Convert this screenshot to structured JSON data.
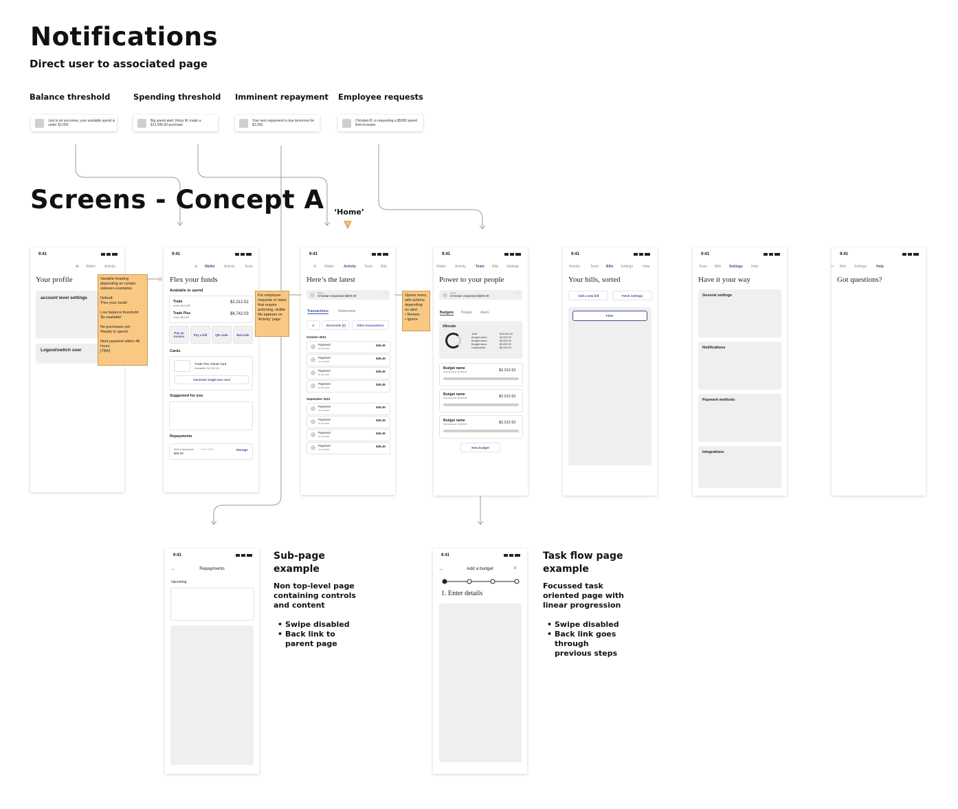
{
  "headings": {
    "notifications": "Notifications",
    "notifications_sub": "Direct user to associated page",
    "screens": "Screens - Concept A",
    "home_label": "‘Home’"
  },
  "notifications": [
    {
      "title": "Balance threshold",
      "text": "Just to let you know, your available spend is under $2,000"
    },
    {
      "title": "Spending threshold",
      "text": "Big spend alert: Ricky M. made a $12,045.00 purchase"
    },
    {
      "title": "Imminent repayment",
      "text": "Your next repayment is due tomorrow for $1,500."
    },
    {
      "title": "Employee requests",
      "text": "Christian B. is requesting a $5000 spend limit increase."
    }
  ],
  "status_time": "9:41",
  "profile": {
    "nav": [
      "Wallet",
      "Activity"
    ],
    "title": "Your profile",
    "account_settings": "account level settings",
    "logout": "Logout/switch user",
    "sticky": "Variable heading depending on certain statuses examples:\n\nDefault:\n'Flex your funds'\n\nLow balance threshold:\n'$x available'\n\nNo purchases yet:\n'Ready to spend'\n\nNext payment within 48 hours\n[TBA]'"
  },
  "wallet": {
    "nav": [
      "Wallet",
      "Activity",
      "Team"
    ],
    "title": "Flex your funds",
    "available": "Available to spend",
    "trade": "Trade",
    "trade_sub": "Limit: $10,000",
    "trade_value": "$2,312.52",
    "trade_plus": "Trade Plus",
    "trade_plus_sub": "Limit: $5,000",
    "trade_plus_value": "$6,742.03",
    "actions": [
      "Pay an invoice",
      "Pay a bill",
      "QR code",
      "Barcode"
    ],
    "cards": "Cards",
    "card_name": "Trade Flex Virtual Card",
    "card_sub": "Available: $1,312.52",
    "generate": "Generate single-use card",
    "suggested": "Suggested for you",
    "repayments": "Repayments",
    "next_repayment": "Next repayment:",
    "next_date": "1 Dec 2021",
    "next_amount": "$45.03",
    "manage": "Manage",
    "sticky": "For employee requests or tasks that require actioning, visible tile appears on 'Activity' page"
  },
  "activity": {
    "nav": [
      "Wallet",
      "Activity",
      "Team",
      "Bills"
    ],
    "title": "Here’s the latest",
    "alert_small": "Action",
    "alert": "Christian requested $500.00",
    "tabs": [
      "Transactions",
      "Statements"
    ],
    "reconcile": "Reconcile (2)",
    "filter": "Filter transactions",
    "month1": "October 2021",
    "month2": "September 2021",
    "rows1": [
      {
        "label": "Payment",
        "date": "13 Oct 2021",
        "amount": "$45.45"
      },
      {
        "label": "Payment",
        "date": "12 Oct 2021",
        "amount": "$45.45"
      },
      {
        "label": "Payment",
        "date": "10 Oct 2021",
        "amount": "$45.45"
      },
      {
        "label": "Payment",
        "date": "10 Oct 2021",
        "amount": "$45.45"
      }
    ],
    "rows2": [
      {
        "label": "Payment",
        "date": "12 Oct 2021",
        "amount": "$45.45"
      },
      {
        "label": "Payment",
        "date": "12 Oct 2021",
        "amount": "$45.45"
      },
      {
        "label": "Payment",
        "date": "12 Oct 2021",
        "amount": "$45.45"
      },
      {
        "label": "Payment",
        "date": "12 Oct 2021",
        "amount": "$45.45"
      }
    ],
    "sticky": "Opens menu with actions depending on alert\n • Review\n • Ignore"
  },
  "team": {
    "nav": [
      "Wallet",
      "Activity",
      "Team",
      "Bills",
      "Settings"
    ],
    "title": "Power to your people",
    "alert_small": "Action",
    "alert": "Christian requested $500.00",
    "tabs": [
      "Budgets",
      "People",
      "Alerts"
    ],
    "allocate": "Allocate",
    "alloc_rows": [
      {
        "label": "Total",
        "value": "$15,000.00"
      },
      {
        "label": "Budget name",
        "value": "$4,000.00"
      },
      {
        "label": "Budget name",
        "value": "$3,000.00"
      },
      {
        "label": "Budget name",
        "value": "$3,000.00"
      },
      {
        "label": "Unallocated",
        "value": "$5,000.00"
      }
    ],
    "budgets": [
      {
        "name": "Budget name",
        "sub": "Total allocated: $4,000.00",
        "value": "$2,312.52"
      },
      {
        "name": "Budget name",
        "sub": "Total allocated: $3,000.00",
        "value": "$2,312.52"
      },
      {
        "name": "Budget name",
        "sub": "Total allocated: $3,000.00",
        "value": "$2,312.52"
      }
    ],
    "new_budget": "New budget"
  },
  "bills": {
    "nav": [
      "Activity",
      "Team",
      "Bills",
      "Settings",
      "Help"
    ],
    "title": "Your bills, sorted",
    "add": "Add a new bill",
    "fetch": "Fetch settings",
    "filter": "Filter"
  },
  "settings": {
    "nav": [
      "Team",
      "Bills",
      "Settings",
      "Help"
    ],
    "title": "Have it your way",
    "sections": [
      "General settings",
      "Notifications",
      "Payment methods",
      "Integrations"
    ]
  },
  "help": {
    "nav": [
      "n",
      "Bills",
      "Settings",
      "Help"
    ],
    "title": "Got questions?"
  },
  "subpage": {
    "title": "Repayments",
    "upcoming": "Upcoming",
    "heading": "Sub-page example",
    "desc": "Non top-level page containing controls and content",
    "bullets": [
      "Swipe disabled",
      "Back link to parent page"
    ]
  },
  "taskflow": {
    "title": "Add a budget",
    "step": "1.  Enter details",
    "heading": "Task flow page example",
    "desc": "Focussed task oriented page with linear progression",
    "bullets": [
      "Swipe disabled",
      "Back link goes through previous steps"
    ]
  },
  "colors": {
    "accent": "#3a4fa0",
    "sticky": "#f9c983",
    "tile": "#efefef"
  }
}
